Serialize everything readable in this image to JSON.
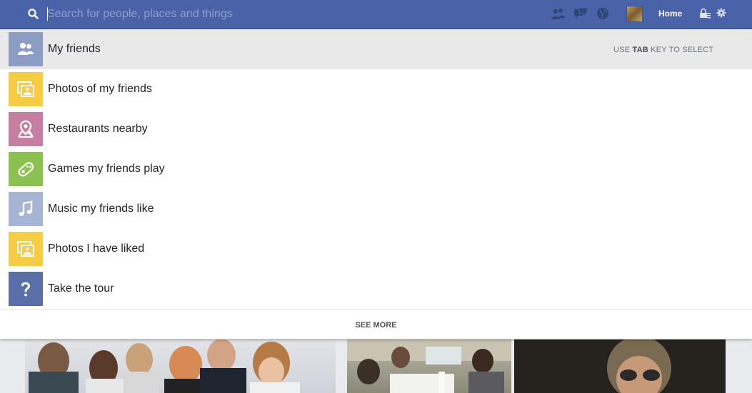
{
  "search": {
    "placeholder": "Search for people, places and things"
  },
  "nav": {
    "home_label": "Home"
  },
  "dropdown": {
    "hint_prefix": "USE ",
    "hint_key": "TAB",
    "hint_suffix": " KEY TO SELECT",
    "items": [
      {
        "label": "My friends",
        "icon": "friends-icon",
        "color": "#8b9dc3"
      },
      {
        "label": "Photos of my friends",
        "icon": "photos-icon",
        "color": "#f7cc45"
      },
      {
        "label": "Restaurants nearby",
        "icon": "map-pin-icon",
        "color": "#c67fa0"
      },
      {
        "label": "Games my friends play",
        "icon": "gamepad-icon",
        "color": "#8cc152"
      },
      {
        "label": "Music my friends like",
        "icon": "music-note-icon",
        "color": "#a7b5d4"
      },
      {
        "label": "Photos I have liked",
        "icon": "photos-icon",
        "color": "#f7cc45"
      },
      {
        "label": "Take the tour",
        "icon": "question-icon",
        "color": "#5a6fa8"
      }
    ],
    "see_more_label": "SEE MORE"
  }
}
